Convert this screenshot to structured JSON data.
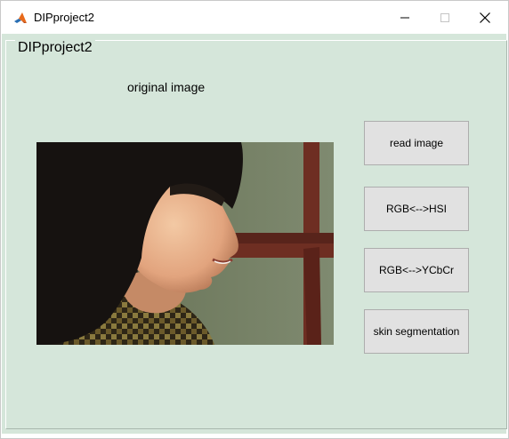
{
  "window": {
    "title": "DIPproject2",
    "controls": {
      "minimize": "minimize",
      "maximize": "maximize",
      "close": "close"
    }
  },
  "panel": {
    "title": "DIPproject2",
    "background": "#d5e6da"
  },
  "axes": {
    "label": "original image"
  },
  "buttons": {
    "read_image": "read image",
    "rgb_hsi": "RGB<-->HSI",
    "rgb_ycbcr": "RGB<-->YCbCr",
    "skin_segmentation": "skin segmentation"
  },
  "icons": {
    "app": "matlab-icon",
    "minimize": "minimize-icon",
    "maximize": "maximize-icon",
    "close": "close-icon"
  }
}
